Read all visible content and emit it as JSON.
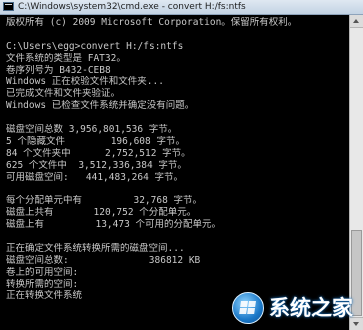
{
  "window": {
    "title": "C:\\Windows\\system32\\cmd.exe - convert  H:/fs:ntfs"
  },
  "console": {
    "lines": [
      "版权所有 (c) 2009 Microsoft Corporation。保留所有权利。",
      "",
      "C:\\Users\\egg>convert H:/fs:ntfs",
      "文件系统的类型是 FAT32。",
      "卷序列号为 B432-CEB8",
      "Windows 正在校验文件和文件夹...",
      "已完成文件和文件夹验证。",
      "Windows 已检查文件系统并确定没有问题。",
      "",
      "磁盘空间总数 3,956,801,536 字节。",
      "5 个隐藏文件        196,608 字节。",
      "84 个文件夹中      2,752,512 字节。",
      "625 个文件中  3,512,336,384 字节。",
      "可用磁盘空间:   441,483,264 字节。",
      "",
      "每个分配单元中有         32,768 字节。",
      "磁盘上共有       120,752 个分配单元。",
      "磁盘上有         13,473 个可用的分配单元。",
      "",
      "正在确定文件系统转换所需的磁盘空间...",
      "磁盘空间总数:              386812 KB",
      "卷上的可用空间:",
      "转换所需的空间:",
      "正在转换文件系统"
    ]
  },
  "watermark": {
    "text": "系统之家"
  },
  "colors": {
    "console_bg": "#000000",
    "console_text": "#c8c8c8",
    "titlebar": "#c3d3e4"
  }
}
